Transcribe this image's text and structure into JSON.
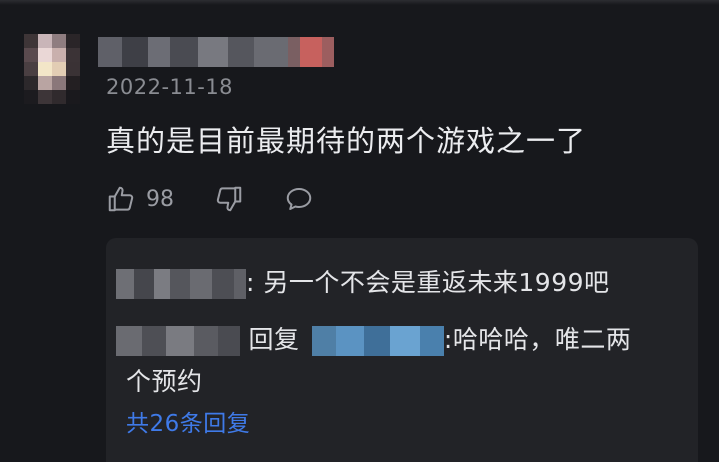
{
  "comment": {
    "date": "2022-11-18",
    "text": "真的是目前最期待的两个游戏之一了",
    "like_count": "98"
  },
  "icons": {
    "like": "thumbs-up-icon",
    "dislike": "thumbs-down-icon",
    "reply": "chat-bubble-icon"
  },
  "replies": {
    "items": [
      {
        "separator": ":",
        "text": "另一个不会是重返未来1999吧"
      },
      {
        "reply_word": "回复",
        "separator": ":",
        "text_line1": "哈哈哈，唯二两",
        "text_line2": "个预约"
      }
    ],
    "more_label": "共26条回复"
  },
  "colors": {
    "background": "#17181c",
    "reply_panel": "#222327",
    "link": "#3f7ae8"
  }
}
